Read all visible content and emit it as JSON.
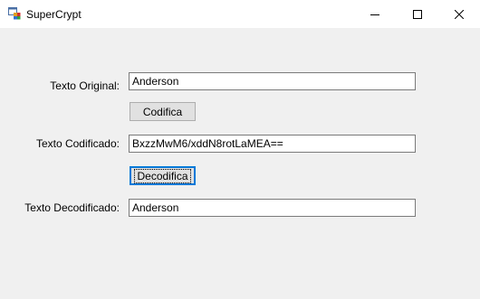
{
  "window": {
    "title": "SuperCrypt",
    "icon": "app-window-icon",
    "controls": [
      "minimize-icon",
      "maximize-icon",
      "close-icon"
    ]
  },
  "form": {
    "original_label": "Texto Original:",
    "original_value": "Anderson",
    "encode_button": "Codifica",
    "encoded_label": "Texto Codificado:",
    "encoded_value": "BxzzMwM6/xddN8rotLaMEA==",
    "decode_button": "Decodifica",
    "decoded_label": "Texto Decodificado:",
    "decoded_value": "Anderson"
  }
}
